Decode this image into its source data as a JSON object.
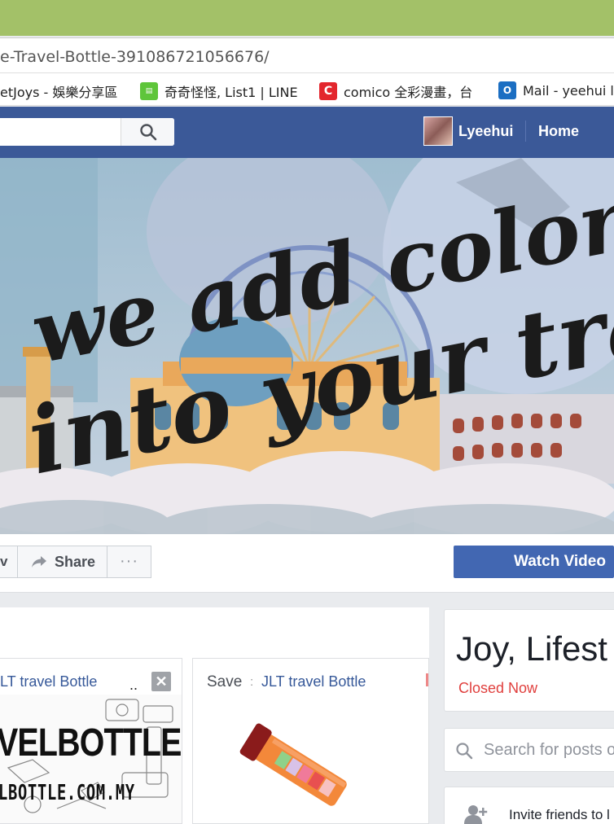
{
  "browser": {
    "url_text": "e-Travel-Bottle-391086721056676/",
    "bookmarks": [
      {
        "label": "etJoys - 娛樂分享區",
        "icon": "page-icon"
      },
      {
        "label": "奇奇怪怪, List1 | LINE",
        "icon": "line-webtoon-icon",
        "color": "#5ec53a"
      },
      {
        "label": "comico 全彩漫畫，台",
        "icon": "comico-icon",
        "color": "#e3262d"
      },
      {
        "label": "Mail - yeehui ly",
        "icon": "outlook-icon",
        "color": "#1b6ec2"
      }
    ]
  },
  "fb_header": {
    "user_name": "Lyeehui",
    "home_label": "Home",
    "brand_color": "#3b5998"
  },
  "cover": {
    "tagline_line1": "we add color",
    "tagline_line2": "into your travel"
  },
  "page_actions": {
    "like_fragment": "v",
    "share_label": "Share",
    "more_label": "···",
    "watch_video_label": "Watch Video"
  },
  "post_cards": [
    {
      "title": "LT travel Bottle",
      "dots": "..",
      "close_label": "✕",
      "image_text_big": "VELBOTTLE",
      "image_text_small": "LBOTTLE.COM.MY"
    },
    {
      "save_label": "Save",
      "separator": ":",
      "title": "JLT travel Bottle"
    }
  ],
  "sidebar": {
    "page_name": "Joy, Lifest",
    "status": "Closed Now",
    "status_color": "#e0403e",
    "search_placeholder": "Search for posts o",
    "invite_label": "Invite friends to l"
  }
}
